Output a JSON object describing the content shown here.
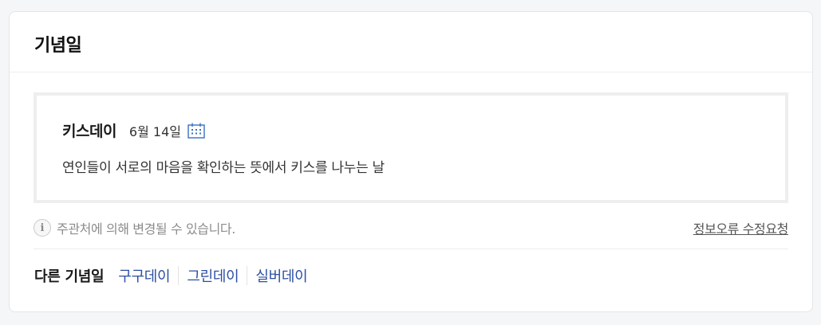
{
  "card": {
    "title": "기념일"
  },
  "anniversary": {
    "name": "키스데이",
    "date": "6월 14일",
    "description": "연인들이 서로의 마음을 확인하는 뜻에서 키스를 나누는 날",
    "calendar_icon": "calendar-icon"
  },
  "notice": {
    "icon": "info-icon",
    "icon_glyph": "i",
    "text": "주관처에 의해 변경될 수 있습니다.",
    "report_link": "정보오류 수정요청"
  },
  "other": {
    "label": "다른 기념일",
    "links": [
      "구구데이",
      "그린데이",
      "실버데이"
    ]
  },
  "colors": {
    "link": "#2c4fa3",
    "calendar_icon": "#3a6fc4"
  }
}
